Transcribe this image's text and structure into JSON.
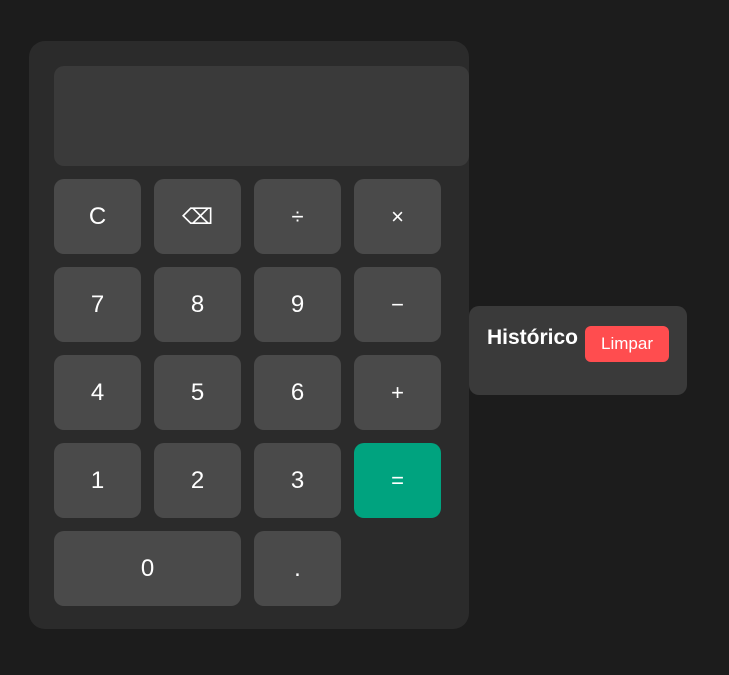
{
  "display": {
    "value": ""
  },
  "keys": [
    {
      "label": "C",
      "name": "clear-key",
      "kind": "fn"
    },
    {
      "label": "⌫",
      "name": "backspace-key",
      "kind": "fn"
    },
    {
      "label": "÷",
      "name": "divide-key",
      "kind": "op"
    },
    {
      "label": "×",
      "name": "multiply-key",
      "kind": "op"
    },
    {
      "label": "7",
      "name": "digit-7-key",
      "kind": "num"
    },
    {
      "label": "8",
      "name": "digit-8-key",
      "kind": "num"
    },
    {
      "label": "9",
      "name": "digit-9-key",
      "kind": "num"
    },
    {
      "label": "−",
      "name": "subtract-key",
      "kind": "op"
    },
    {
      "label": "4",
      "name": "digit-4-key",
      "kind": "num"
    },
    {
      "label": "5",
      "name": "digit-5-key",
      "kind": "num"
    },
    {
      "label": "6",
      "name": "digit-6-key",
      "kind": "num"
    },
    {
      "label": "+",
      "name": "add-key",
      "kind": "op"
    },
    {
      "label": "1",
      "name": "digit-1-key",
      "kind": "num"
    },
    {
      "label": "2",
      "name": "digit-2-key",
      "kind": "num"
    },
    {
      "label": "3",
      "name": "digit-3-key",
      "kind": "num"
    },
    {
      "label": "=",
      "name": "equals-key",
      "kind": "equals"
    },
    {
      "label": "0",
      "name": "digit-0-key",
      "kind": "zero"
    },
    {
      "label": ".",
      "name": "decimal-key",
      "kind": "num"
    }
  ],
  "history": {
    "title": "Histórico",
    "clear_label": "Limpar",
    "items": []
  },
  "colors": {
    "equals": "#00a37f",
    "clear_history": "#ff4d4f"
  }
}
